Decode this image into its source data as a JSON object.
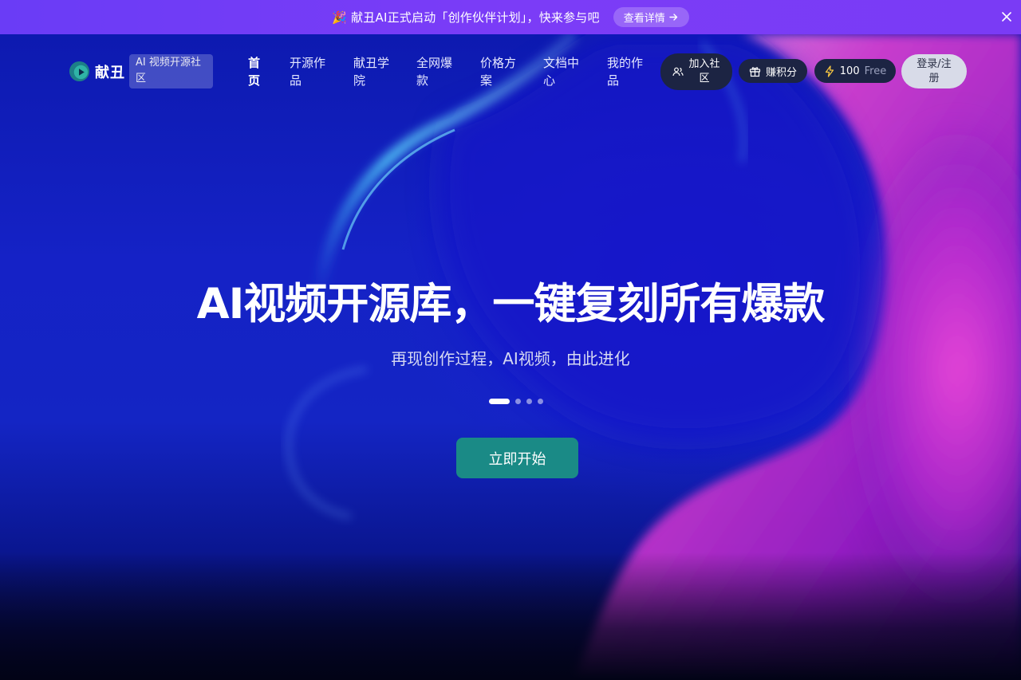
{
  "announcement": {
    "text": "🎉 献丑AI正式启动「创作伙伴计划」，快来参与吧",
    "button_label": "查看详情",
    "close_icon": "close-icon"
  },
  "nav": {
    "logo_text": "献丑",
    "logo_tag": "AI 视频开源社区",
    "items": [
      {
        "label": "首页",
        "active": true
      },
      {
        "label": "开源作品",
        "active": false
      },
      {
        "label": "献丑学院",
        "active": false
      },
      {
        "label": "全网爆款",
        "active": false
      },
      {
        "label": "价格方案",
        "active": false
      },
      {
        "label": "文档中心",
        "active": false
      },
      {
        "label": "我的作品",
        "active": false
      }
    ],
    "community_label": "加入社区",
    "points_label": "赚积分",
    "credits": {
      "amount": "100",
      "plan": "Free"
    },
    "login_label": "登录/注册"
  },
  "hero": {
    "headline": "AI视频开源库，一键复刻所有爆款",
    "subhead": "再现创作过程，AI视频，由此进化",
    "carousel": {
      "total": 4,
      "active_index": 0
    },
    "cta_label": "立即开始"
  },
  "colors": {
    "announce_bg": "#7b3cf7",
    "cta": "#1a8a86",
    "hero_blue": "#1425c4",
    "accent_pink": "#e23ad8"
  }
}
